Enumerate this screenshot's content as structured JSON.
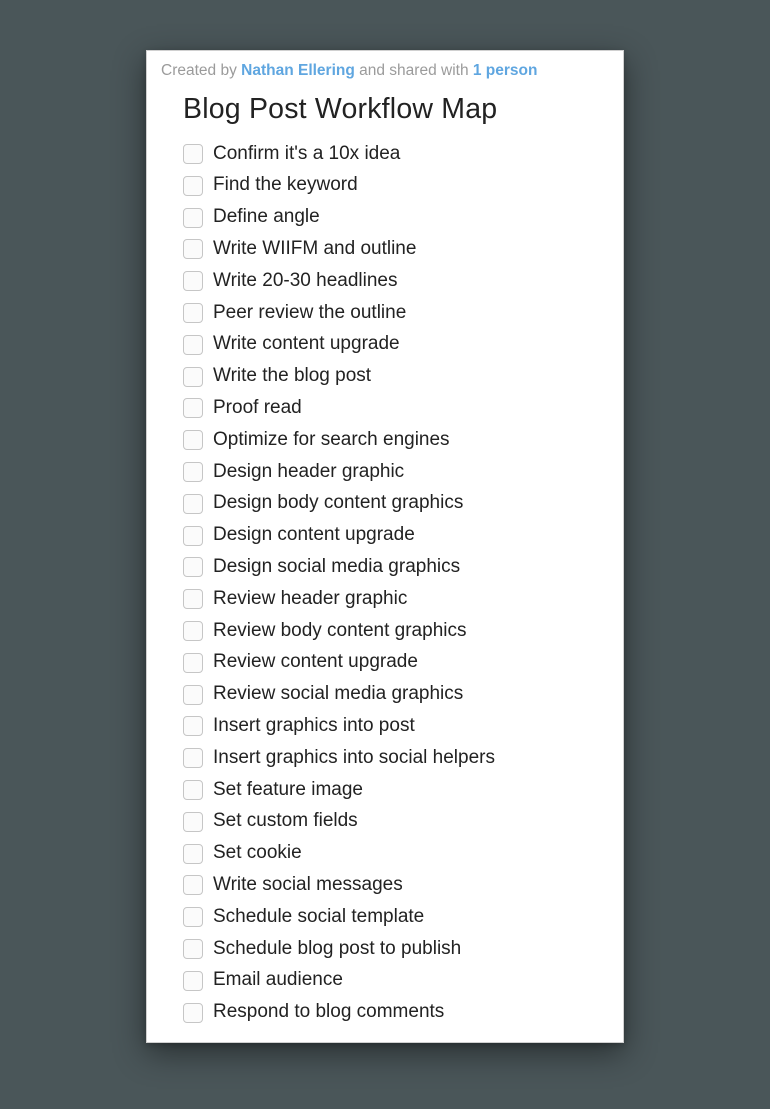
{
  "meta": {
    "prefix": "Created by ",
    "author": "Nathan Ellering",
    "middle": " and shared with ",
    "shared_with": "1 person"
  },
  "title": "Blog Post Workflow Map",
  "items": [
    "Confirm it's a 10x idea",
    "Find the keyword",
    "Define angle",
    "Write WIIFM and outline",
    "Write 20-30 headlines",
    "Peer review the outline",
    "Write content upgrade",
    "Write the blog post",
    "Proof read",
    "Optimize for search engines",
    "Design header graphic",
    "Design body content graphics",
    "Design content upgrade",
    "Design social media graphics",
    "Review header graphic",
    "Review body content graphics",
    "Review content upgrade",
    "Review social media graphics",
    "Insert graphics into post",
    "Insert graphics into social helpers",
    "Set feature image",
    "Set custom fields",
    "Set cookie",
    "Write social messages",
    "Schedule social template",
    "Schedule blog post to publish",
    "Email audience",
    "Respond to blog comments"
  ]
}
